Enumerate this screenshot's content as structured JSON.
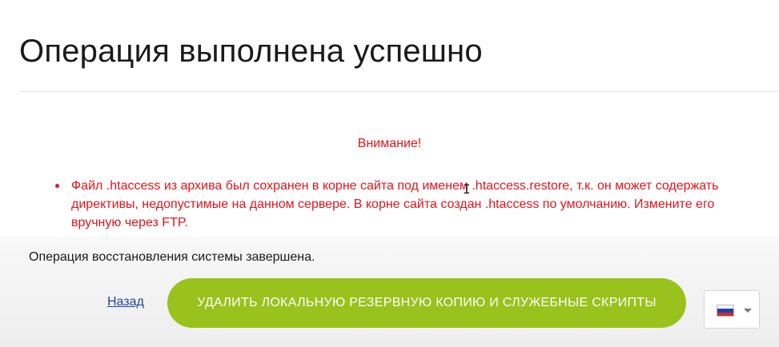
{
  "header": {
    "title": "Операция выполнена успешно"
  },
  "warning": {
    "title": "Внимание!",
    "items": [
      {
        "text": "Файл .htaccess из архива был сохранен в корне сайта под именем .htaccess.restore, т.к. он может содержать директивы, недопустимые на данном сервере. В корне сайта создан .htaccess по умолчанию. Измените его вручную через FTP."
      }
    ]
  },
  "footer": {
    "status_text": "Операция восстановления системы завершена.",
    "back_label": "Назад",
    "delete_button_label": "Удалить локальную резервную копию и служебные скрипты",
    "language": {
      "selected_icon": "russian-flag-icon"
    }
  },
  "colors": {
    "warning": "#e2141b",
    "button": "#99c21c",
    "link": "#1f3fa8",
    "flag_white": "#ffffff",
    "flag_blue": "#1c3fb8",
    "flag_red": "#d52b1e"
  }
}
